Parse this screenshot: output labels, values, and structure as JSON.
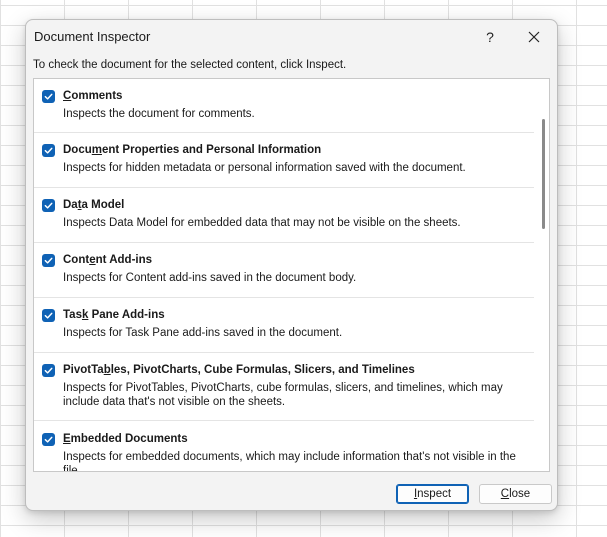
{
  "dialog": {
    "title": "Document Inspector",
    "help_label": "?",
    "instruction": "To check the document for the selected content, click Inspect."
  },
  "items": [
    {
      "label_pre": "",
      "label_key": "C",
      "label_post": "omments",
      "checked": true,
      "description": "Inspects the document for comments."
    },
    {
      "label_pre": "Docu",
      "label_key": "m",
      "label_post": "ent Properties and Personal Information",
      "checked": true,
      "description": "Inspects for hidden metadata or personal information saved with the document."
    },
    {
      "label_pre": "Da",
      "label_key": "t",
      "label_post": "a Model",
      "checked": true,
      "description": "Inspects Data Model for embedded data that may not be visible on the sheets."
    },
    {
      "label_pre": "Cont",
      "label_key": "e",
      "label_post": "nt Add-ins",
      "checked": true,
      "description": "Inspects for Content add-ins saved in the document body."
    },
    {
      "label_pre": "Tas",
      "label_key": "k",
      "label_post": " Pane Add-ins",
      "checked": true,
      "description": "Inspects for Task Pane add-ins saved in the document."
    },
    {
      "label_pre": "PivotTa",
      "label_key": "b",
      "label_post": "les, PivotCharts, Cube Formulas, Slicers, and Timelines",
      "checked": true,
      "description": "Inspects for PivotTables, PivotCharts, cube formulas, slicers, and timelines, which may include data that's not visible on the sheets."
    },
    {
      "label_pre": "",
      "label_key": "E",
      "label_post": "mbedded Documents",
      "checked": true,
      "description": "Inspects for embedded documents, which may include information that's not visible in the file."
    }
  ],
  "buttons": {
    "inspect_pre": "",
    "inspect_key": "I",
    "inspect_post": "nspect",
    "close_pre": "",
    "close_key": "C",
    "close_post": "lose"
  },
  "colors": {
    "accent": "#0f62b5"
  }
}
